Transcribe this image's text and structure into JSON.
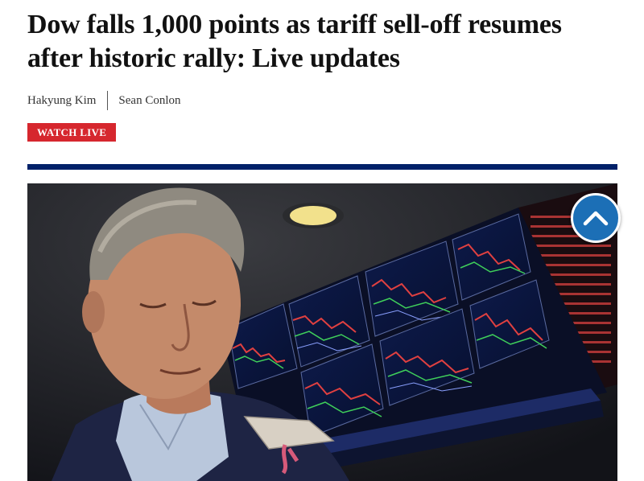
{
  "article": {
    "headline": "Dow falls 1,000 points as tariff sell-off resumes after historic rally: Live updates",
    "authors": [
      "Hakyung Kim",
      "Sean Conlon"
    ],
    "watch_live_label": "WATCH LIVE"
  },
  "colors": {
    "watch_live_bg": "#d6272e",
    "rule": "#012169",
    "scroll_button": "#1c6fb6"
  },
  "icons": {
    "scroll_top": "chevron-up-icon"
  }
}
